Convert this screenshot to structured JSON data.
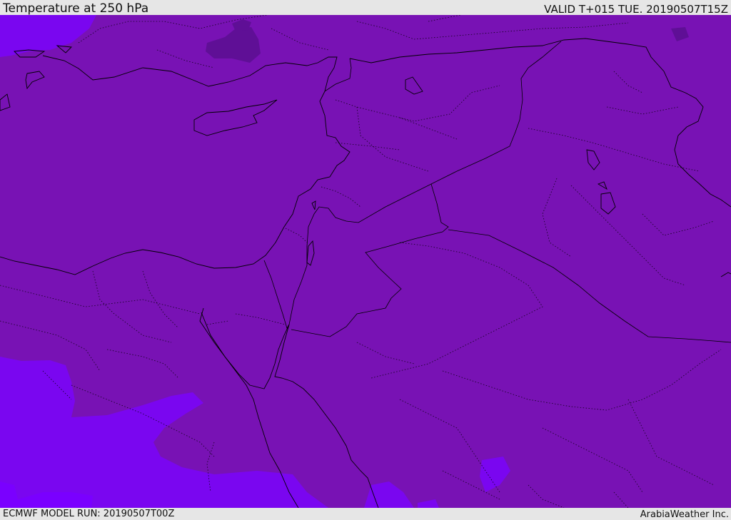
{
  "header": {
    "title": "Temperature at 250 hPa",
    "valid_time": "VALID T+015 TUE. 20190507T15Z"
  },
  "footer": {
    "model_run": "ECMWF MODEL RUN: 20190507T00Z",
    "credit": "ArabiaWeather Inc."
  },
  "map": {
    "field": "Temperature at 250 hPa",
    "colors": {
      "base": "#7812b4",
      "warmer_patch": "#7a06f0",
      "warmest_patch": "#7a00ff",
      "cold_patch": "#5f0f96"
    }
  }
}
